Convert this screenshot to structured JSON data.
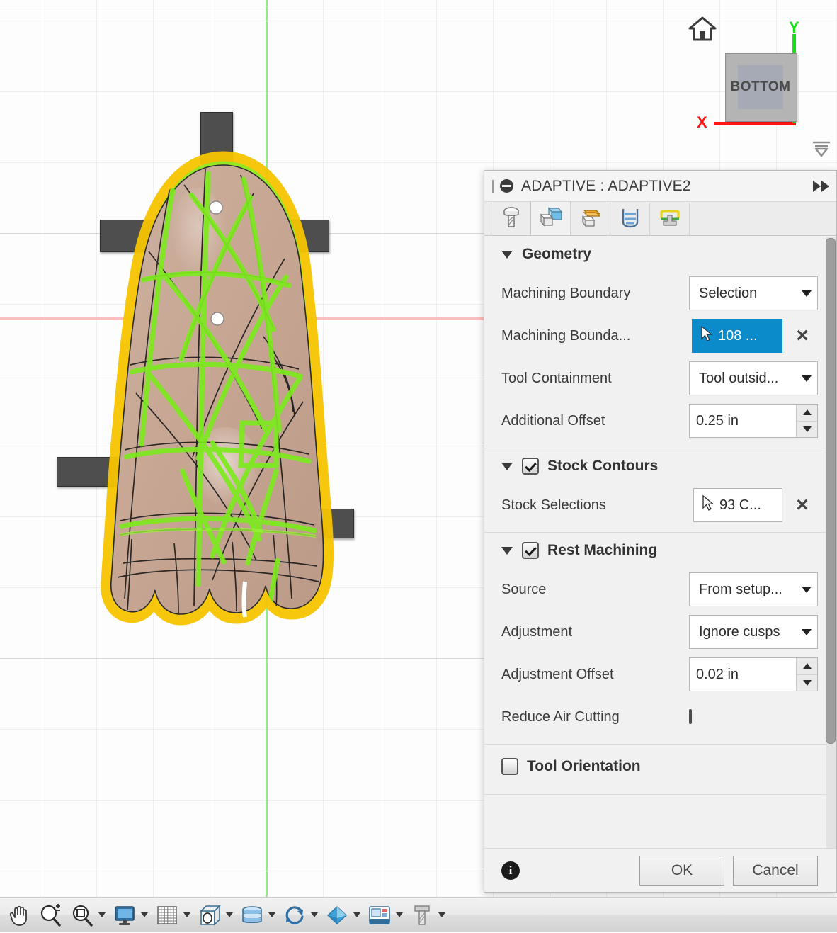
{
  "viewport": {
    "home_icon": "home-icon",
    "viewcube_label": "BOTTOM",
    "axis_x_label": "X",
    "axis_y_label": "Y",
    "axis_x_color": "#ff1414",
    "axis_y_color": "#12e312",
    "grid_color": "#e8e8e8",
    "model": {
      "name": "foot-model",
      "body_color": "#c9ab98",
      "selection_highlight_color": "#7dea1e",
      "boundary_highlight_color": "#f5c400",
      "wireframe_color": "#1a1a1a",
      "clamp_color": "#4e4e4e",
      "clamp_count": 4
    }
  },
  "dialog": {
    "title": "ADAPTIVE : ADAPTIVE2",
    "expand_icon": "fast-forward-icon",
    "grip_icon": "drag-grip-icon",
    "status_icon": "suppress-icon",
    "tabs": [
      {
        "id": "tool",
        "icon": "tool-icon",
        "active": false
      },
      {
        "id": "geometry",
        "icon": "geometry-icon",
        "active": true
      },
      {
        "id": "heights",
        "icon": "heights-icon",
        "active": false
      },
      {
        "id": "passes",
        "icon": "passes-icon",
        "active": false
      },
      {
        "id": "linking",
        "icon": "linking-icon",
        "active": false
      }
    ],
    "sections": [
      {
        "id": "geometry",
        "title": "Geometry",
        "expanded": true,
        "has_checkbox": false,
        "rows": [
          {
            "id": "machining-boundary",
            "label": "Machining Boundary",
            "type": "select",
            "value": "Selection"
          },
          {
            "id": "machining-boundary-selection",
            "label": "Machining Bounda...",
            "type": "selection",
            "value": "108 ...",
            "active": true,
            "clear": "×"
          },
          {
            "id": "tool-containment",
            "label": "Tool Containment",
            "type": "select",
            "value": "Tool outsid..."
          },
          {
            "id": "additional-offset",
            "label": "Additional Offset",
            "type": "spinner",
            "value": "0.25 in"
          }
        ]
      },
      {
        "id": "stock-contours",
        "title": "Stock Contours",
        "expanded": true,
        "has_checkbox": true,
        "checked": true,
        "rows": [
          {
            "id": "stock-selections",
            "label": "Stock Selections",
            "type": "selection",
            "value": "93 C...",
            "active": false,
            "clear": "×"
          }
        ]
      },
      {
        "id": "rest-machining",
        "title": "Rest Machining",
        "expanded": true,
        "has_checkbox": true,
        "checked": true,
        "rows": [
          {
            "id": "source",
            "label": "Source",
            "type": "select",
            "value": "From setup..."
          },
          {
            "id": "adjustment",
            "label": "Adjustment",
            "type": "select",
            "value": "Ignore cusps"
          },
          {
            "id": "adjustment-offset",
            "label": "Adjustment Offset",
            "type": "spinner",
            "value": "0.02 in"
          },
          {
            "id": "reduce-air-cutting",
            "label": "Reduce Air Cutting",
            "type": "checkbox",
            "checked": false
          }
        ]
      },
      {
        "id": "tool-orientation",
        "title": "Tool Orientation",
        "expanded": false,
        "has_checkbox": true,
        "checked": false,
        "rows": []
      }
    ],
    "footer": {
      "info_icon": "info-icon",
      "info_glyph": "i",
      "ok_label": "OK",
      "cancel_label": "Cancel"
    },
    "accent_color": "#0b8bc9"
  },
  "toolbar": {
    "items": [
      {
        "id": "pan",
        "icon": "pan-hand-icon",
        "caret": false
      },
      {
        "id": "zoom",
        "icon": "zoom-plus-minus-icon",
        "caret": false
      },
      {
        "id": "zoom-window",
        "icon": "zoom-window-icon",
        "caret": true
      },
      {
        "id": "display-settings",
        "icon": "monitor-icon",
        "caret": true
      },
      {
        "id": "grid-snaps",
        "icon": "grid-icon",
        "caret": true
      },
      {
        "id": "viewports",
        "icon": "cube-viewport-icon",
        "caret": true
      },
      {
        "id": "layers",
        "icon": "layers-icon",
        "caret": true
      },
      {
        "id": "refresh",
        "icon": "refresh-circle-icon",
        "caret": true
      },
      {
        "id": "appearance",
        "icon": "diamond-icon",
        "caret": true
      },
      {
        "id": "simulation",
        "icon": "machine-icon",
        "caret": true
      },
      {
        "id": "tool-library",
        "icon": "tool-bit-icon",
        "caret": true
      }
    ]
  }
}
